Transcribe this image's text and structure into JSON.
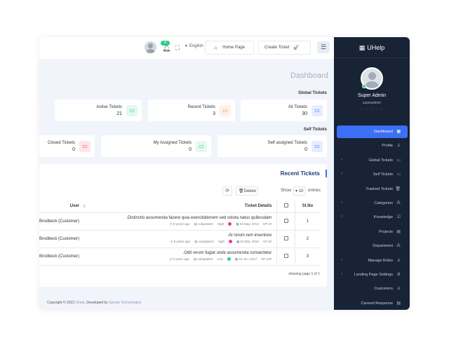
{
  "header": {
    "notif_count": "4",
    "language": "English",
    "home_label": "Home Page",
    "create_label": "Create Ticket"
  },
  "page_title": "Dashboard",
  "global": {
    "heading": "Global Tickets",
    "cards": [
      {
        "label": "Active Tickets",
        "value": "21",
        "color": "#2dce89"
      },
      {
        "label": "Recent Tickets",
        "value": "3",
        "color": "#fb8c3c"
      },
      {
        "label": "All Tickets",
        "value": "30",
        "color": "#3b6ff5"
      }
    ]
  },
  "self": {
    "heading": "Self Tickets",
    "cards": [
      {
        "label": "Closed Tickets",
        "value": "0",
        "color": "#f5365c"
      },
      {
        "label": "My Assigned Tickets",
        "value": "0",
        "color": "#2dce89"
      },
      {
        "label": "Self assigned Tickets",
        "value": "0",
        "color": "#3b6ff5"
      }
    ]
  },
  "recent": {
    "title": "Recent Tickets",
    "delete_label": "Delete",
    "show_label": "Show",
    "show_value": "10",
    "entries_label": "entries",
    "columns": {
      "user": "User",
      "details": "Ticket Details",
      "slno": "Sl.No"
    },
    "rows": [
      {
        "user": "Brodbeck (Customer)",
        "subject": ".Distinctio assumenda facere quia exercitationem sed soluta natus quibusdam",
        "ago": "9 years ago",
        "category": "voluptatem",
        "priority": "High",
        "priority_color": "#e83e8c",
        "date": "04 May, 2013",
        "id": "SP-1#",
        "sl": "1"
      },
      {
        "user": "Brodbeck (Customer)",
        "subject": ".At rerum rem inventore",
        "ago": "8 years ago",
        "category": "voluptatem",
        "priority": "High",
        "priority_color": "#e83e8c",
        "date": "03 Mar, 2019",
        "id": "SP-2#",
        "sl": "2"
      },
      {
        "user": "Brodbeck (Customer)",
        "subject": ".Odit rerum fugiat unde assumenda consectetur",
        "ago": "5 years ago",
        "category": "voluptatem",
        "priority": "Low",
        "priority_color": "#2dce89",
        "date": "19 Jun, 2017",
        "id": "SP-13#",
        "sl": "3"
      }
    ],
    "showing": "showing page 1 of 1"
  },
  "footer": {
    "prefix": "Copyright © 2022 ",
    "brand": "Uhelp",
    "middle": ". Developed by ",
    "dev": "Spruko Technologies"
  },
  "sidebar": {
    "brand": "UHelp",
    "user_name": "Super Admin",
    "user_role": "superadmin",
    "items": [
      {
        "label": "Dashboard",
        "icon": "▦",
        "arrow": false,
        "active": true
      },
      {
        "label": "Profile",
        "icon": "♙",
        "arrow": false,
        "active": false
      },
      {
        "label": "Global Tickets",
        "icon": "▭",
        "arrow": true,
        "active": false
      },
      {
        "label": "Self Tickets",
        "icon": "▭",
        "arrow": true,
        "active": false
      },
      {
        "label": "Trashed Tickets",
        "icon": "🗑",
        "arrow": false,
        "active": false
      },
      {
        "label": "Categories",
        "icon": "⁂",
        "arrow": true,
        "active": false
      },
      {
        "label": "Knowledge",
        "icon": "☑",
        "arrow": true,
        "active": false
      },
      {
        "label": "Projects",
        "icon": "▤",
        "arrow": false,
        "active": false
      },
      {
        "label": "Department",
        "icon": "⁂",
        "arrow": false,
        "active": false
      },
      {
        "label": "Manage Roles",
        "icon": "♙",
        "arrow": true,
        "active": false
      },
      {
        "label": "Landing Page Settings",
        "icon": "⚙",
        "arrow": true,
        "active": false
      },
      {
        "label": "Customers",
        "icon": "♙",
        "arrow": false,
        "active": false
      },
      {
        "label": "Canned Response",
        "icon": "▤",
        "arrow": false,
        "active": false
      }
    ]
  }
}
